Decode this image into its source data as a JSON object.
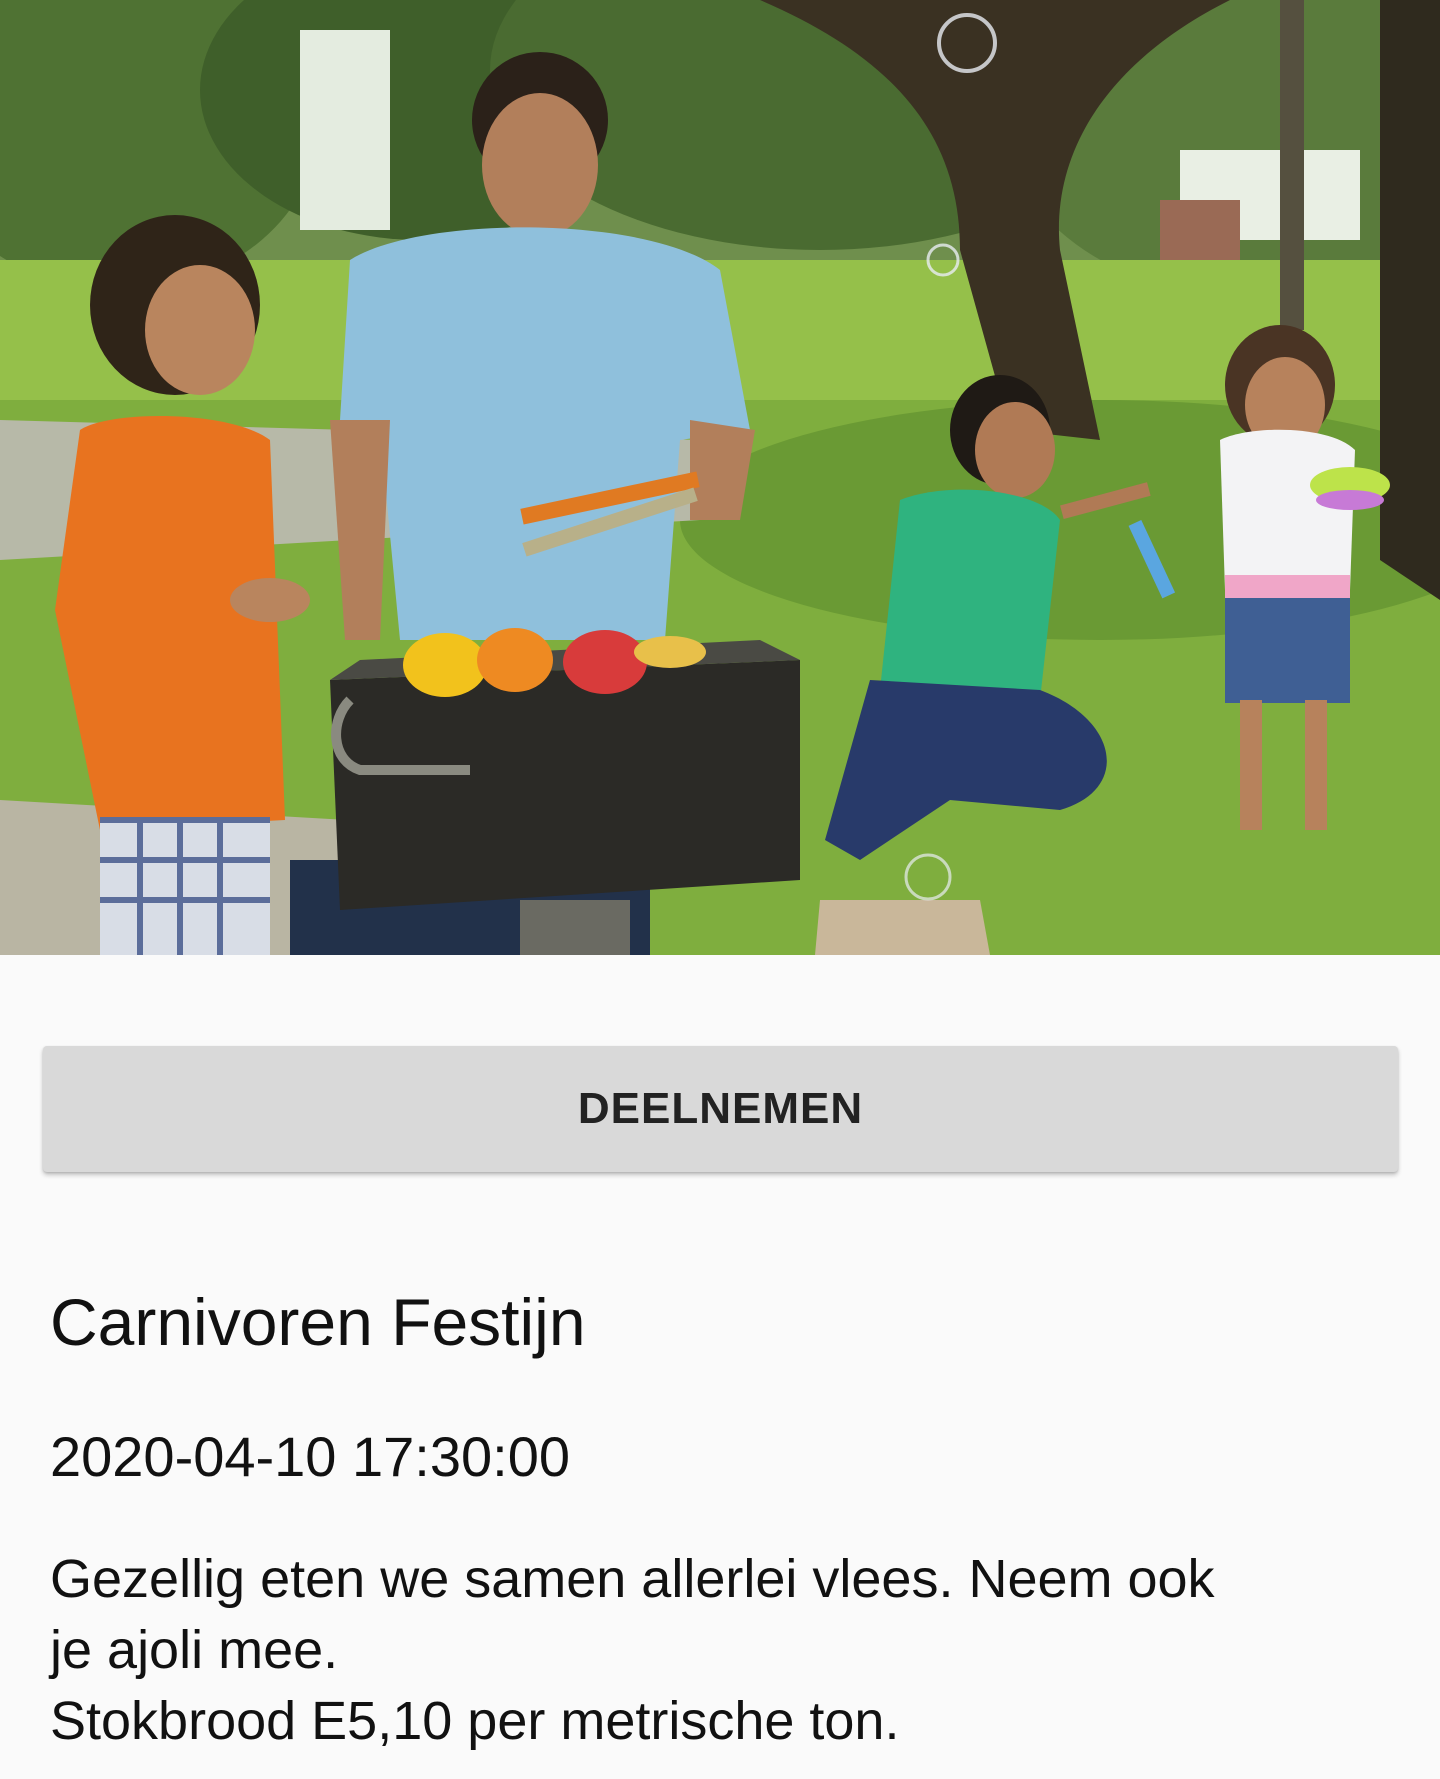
{
  "event": {
    "image_alt": "Family barbecue in the park",
    "join_label": "DEELNEMEN",
    "title": "Carnivoren Festijn",
    "datetime": "2020-04-10 17:30:00",
    "description_lines": [
      "Gezellig eten we samen allerlei vlees. Neem ook",
      "je ajoli mee.",
      "Stokbrood E5,10 per metrische ton."
    ]
  },
  "colors": {
    "page_background": "#fafafa",
    "button_background": "#d9d9d9",
    "text": "#111111"
  }
}
